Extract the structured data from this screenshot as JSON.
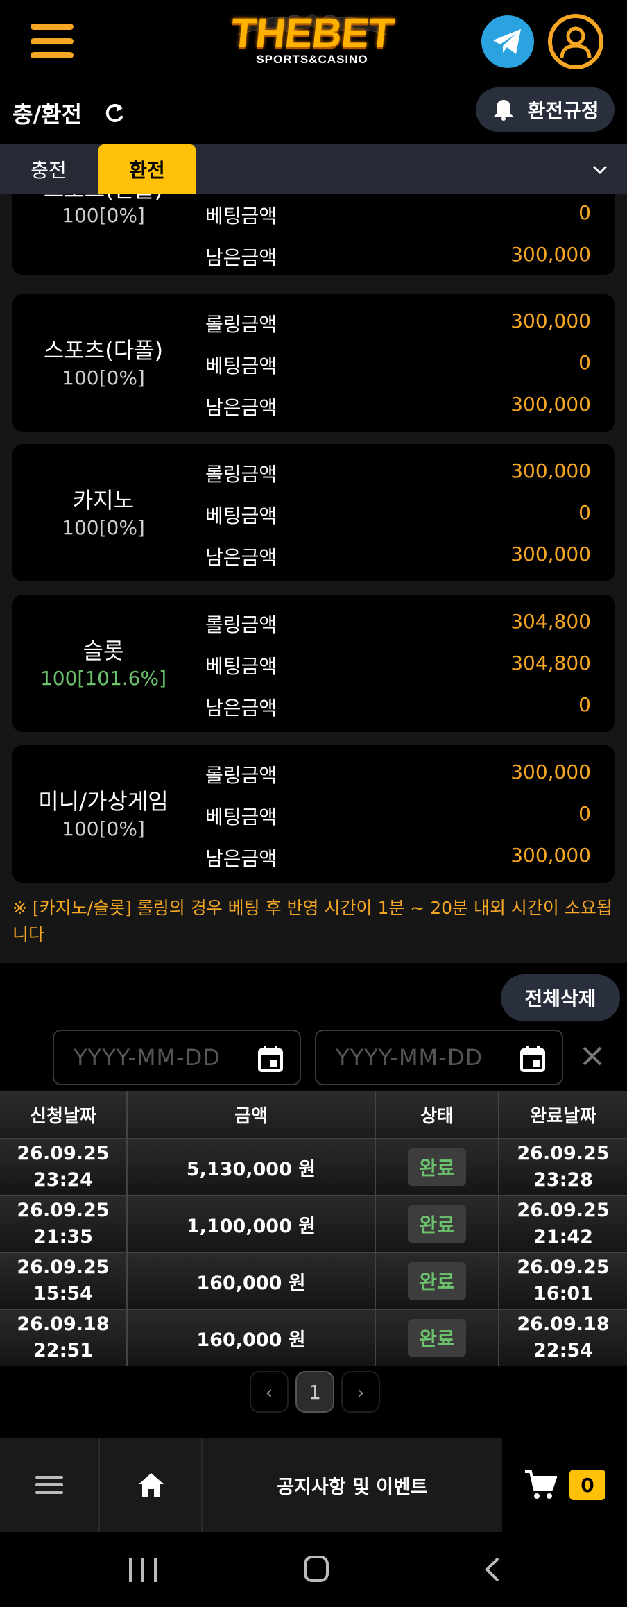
{
  "header": {
    "logo_main": "THEBET",
    "logo_sub": "SPORTS&CASINO"
  },
  "title_row": {
    "title": "충/환전",
    "rules_button": "환전규정"
  },
  "tabs": {
    "charge": "충전",
    "exchange": "환전",
    "active": "exchange"
  },
  "labels": {
    "rolling": "롤링금액",
    "betting": "베팅금액",
    "remaining": "남은금액"
  },
  "cards": [
    {
      "name": "스포츠(단폴)",
      "pct": "100[0%]",
      "rolling": "",
      "betting": "0",
      "remaining": "300,000"
    },
    {
      "name": "스포츠(다폴)",
      "pct": "100[0%]",
      "rolling": "300,000",
      "betting": "0",
      "remaining": "300,000"
    },
    {
      "name": "카지노",
      "pct": "100[0%]",
      "rolling": "300,000",
      "betting": "0",
      "remaining": "300,000"
    },
    {
      "name": "슬롯",
      "pct": "100[101.6%]",
      "rolling": "304,800",
      "betting": "304,800",
      "remaining": "0"
    },
    {
      "name": "미니/가상게임",
      "pct": "100[0%]",
      "rolling": "300,000",
      "betting": "0",
      "remaining": "300,000"
    }
  ],
  "notice": "※ [카지노/슬롯] 롤링의 경우 베팅 후 반영 시간이 1분 ~ 20분 내외 시간이 소요됩니다",
  "filter": {
    "delete_all": "전체삭제",
    "start_placeholder": "YYYY-MM-DD",
    "end_placeholder": "YYYY-MM-DD"
  },
  "table": {
    "headers": [
      "신청날짜",
      "금액",
      "상태",
      "완료날짜"
    ],
    "rows": [
      {
        "req_date": "26.09.25",
        "req_time": "23:24",
        "amount": "5,130,000 원",
        "status": "완료",
        "done_date": "26.09.25",
        "done_time": "23:28"
      },
      {
        "req_date": "26.09.25",
        "req_time": "21:35",
        "amount": "1,100,000 원",
        "status": "완료",
        "done_date": "26.09.25",
        "done_time": "21:42"
      },
      {
        "req_date": "26.09.25",
        "req_time": "15:54",
        "amount": "160,000 원",
        "status": "완료",
        "done_date": "26.09.25",
        "done_time": "16:01"
      },
      {
        "req_date": "26.09.18",
        "req_time": "22:51",
        "amount": "160,000 원",
        "status": "완료",
        "done_date": "26.09.18",
        "done_time": "22:54"
      }
    ]
  },
  "pagination": {
    "prev": "‹",
    "current": "1",
    "next": "›"
  },
  "bottom_bar": {
    "notice_label": "공지사항 및 이벤트",
    "cart_count": "0"
  },
  "colors": {
    "accent": "#ffc107",
    "orange": "#f5a623",
    "status_green": "#6cc26c",
    "telegram": "#2aa3e0"
  }
}
